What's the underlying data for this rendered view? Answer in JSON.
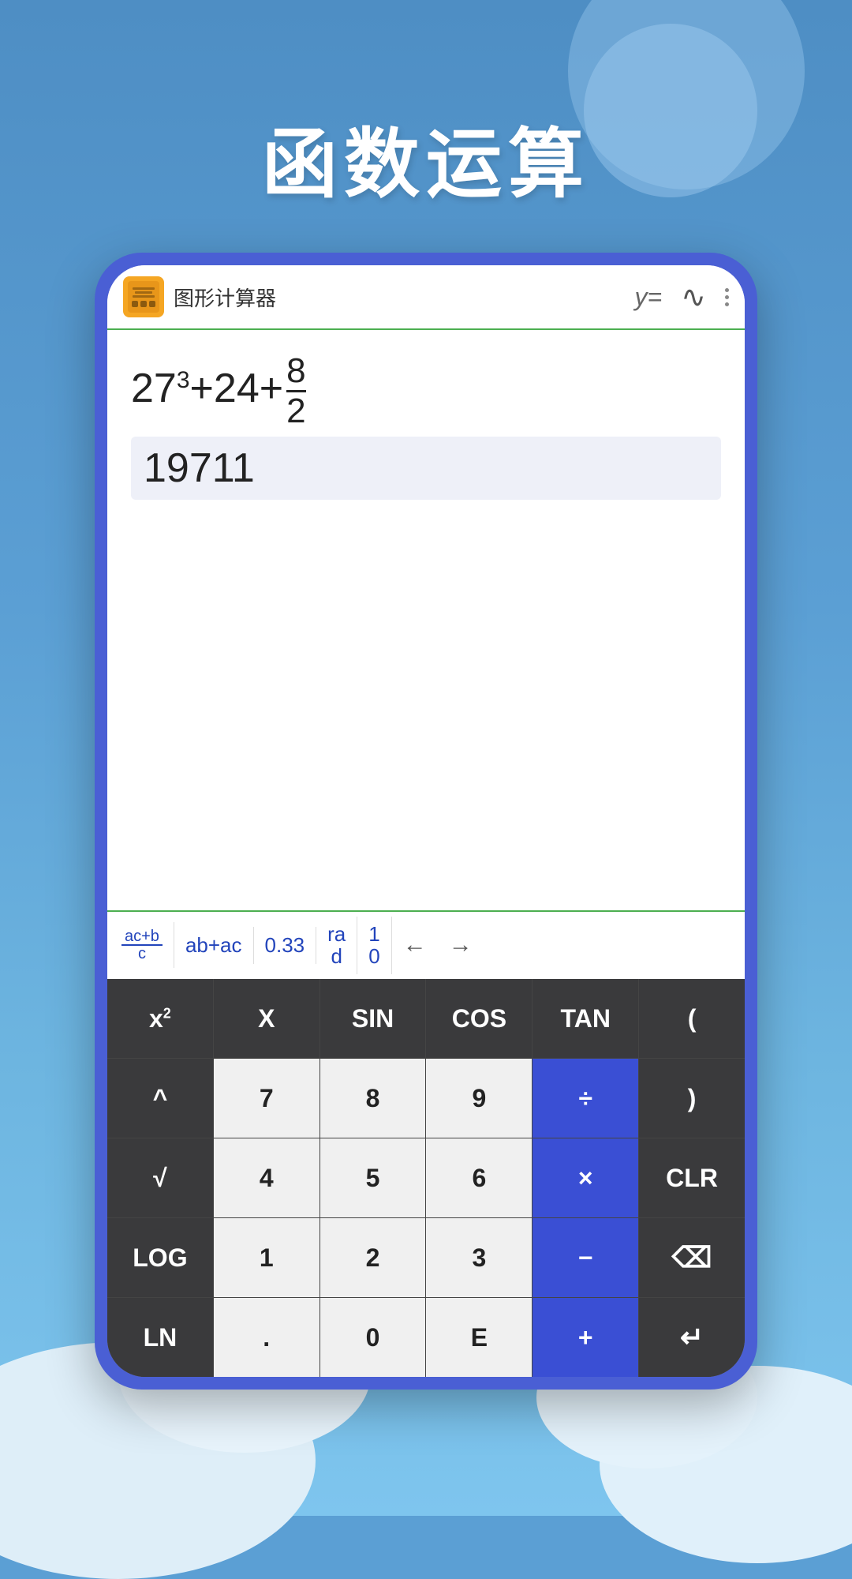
{
  "background": {
    "color_top": "#4e8ec4",
    "color_bottom": "#7ec5ee"
  },
  "title": "函数运算",
  "app": {
    "name": "图形计算器",
    "topbar_btn_y": "y=",
    "topbar_btn_wave": "∿"
  },
  "display": {
    "expression": "27³+24+",
    "fraction_num": "8",
    "fraction_den": "2",
    "result": "19711"
  },
  "toolbar": {
    "items": [
      {
        "label": "ac+b/c",
        "type": "fraction",
        "top": "ac+b",
        "bot": "c"
      },
      {
        "label": "ab+ac",
        "type": "text"
      },
      {
        "label": "0.33",
        "type": "text"
      },
      {
        "label": "ra d",
        "type": "text"
      },
      {
        "label": "1 0",
        "type": "text"
      }
    ],
    "arrow_left": "←",
    "arrow_right": "→"
  },
  "keyboard": {
    "rows": [
      [
        {
          "label": "x²",
          "style": "dark"
        },
        {
          "label": "X",
          "style": "dark"
        },
        {
          "label": "SIN",
          "style": "dark"
        },
        {
          "label": "COS",
          "style": "dark"
        },
        {
          "label": "TAN",
          "style": "dark"
        },
        {
          "label": "(",
          "style": "dark"
        }
      ],
      [
        {
          "label": "^",
          "style": "dark"
        },
        {
          "label": "7",
          "style": "light"
        },
        {
          "label": "8",
          "style": "light"
        },
        {
          "label": "9",
          "style": "light"
        },
        {
          "label": "÷",
          "style": "blue"
        },
        {
          "label": ")",
          "style": "dark"
        }
      ],
      [
        {
          "label": "√",
          "style": "dark"
        },
        {
          "label": "4",
          "style": "light"
        },
        {
          "label": "5",
          "style": "light"
        },
        {
          "label": "6",
          "style": "light"
        },
        {
          "label": "×",
          "style": "blue"
        },
        {
          "label": "CLR",
          "style": "dark"
        }
      ],
      [
        {
          "label": "LOG",
          "style": "dark"
        },
        {
          "label": "1",
          "style": "light"
        },
        {
          "label": "2",
          "style": "light"
        },
        {
          "label": "3",
          "style": "light"
        },
        {
          "label": "−",
          "style": "blue"
        },
        {
          "label": "⌫",
          "style": "dark"
        }
      ],
      [
        {
          "label": "LN",
          "style": "dark"
        },
        {
          "label": ".",
          "style": "light"
        },
        {
          "label": "0",
          "style": "light"
        },
        {
          "label": "E",
          "style": "light"
        },
        {
          "label": "+",
          "style": "blue"
        },
        {
          "label": "↵",
          "style": "dark"
        }
      ]
    ]
  }
}
